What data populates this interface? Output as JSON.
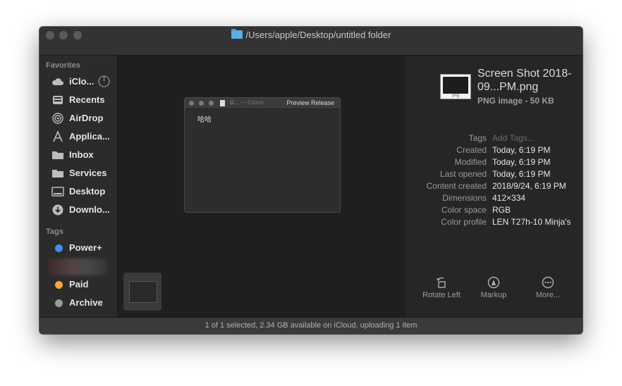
{
  "window": {
    "path": "/Users/apple/Desktop/untitled folder"
  },
  "sidebar": {
    "favorites_title": "Favorites",
    "favorites": [
      {
        "label": "iClo...",
        "icon": "cloud-icon"
      },
      {
        "label": "Recents",
        "icon": "clock-icon"
      },
      {
        "label": "AirDrop",
        "icon": "airdrop-icon"
      },
      {
        "label": "Applica...",
        "icon": "applications-icon"
      },
      {
        "label": "Inbox",
        "icon": "folder-icon"
      },
      {
        "label": "Services",
        "icon": "folder-icon"
      },
      {
        "label": "Desktop",
        "icon": "desktop-icon"
      },
      {
        "label": "Downlo...",
        "icon": "download-icon"
      }
    ],
    "tags_title": "Tags",
    "tags": [
      {
        "label": "Power+",
        "color": "#3b8ff3"
      },
      {
        "label": "Paid",
        "color": "#f6a93a"
      },
      {
        "label": "Archive",
        "color": "#9a9a9a"
      }
    ]
  },
  "preview_window": {
    "title": "U...",
    "edited": "— Edited",
    "app": "Preview Release",
    "content": "哈哈"
  },
  "preview": {
    "file_name": "Screen Shot 2018-09...PM.png",
    "file_type": "PNG image - 50 KB",
    "icon_label": "png",
    "info": [
      {
        "key": "Tags",
        "value": "Add Tags..."
      },
      {
        "key": "Created",
        "value": "Today, 6:19 PM"
      },
      {
        "key": "Modified",
        "value": "Today, 6:19 PM"
      },
      {
        "key": "Last opened",
        "value": "Today, 6:19 PM"
      },
      {
        "key": "Content created",
        "value": "2018/9/24, 6:19 PM"
      },
      {
        "key": "Dimensions",
        "value": "412×334"
      },
      {
        "key": "Color space",
        "value": "RGB"
      },
      {
        "key": "Color profile",
        "value": "LEN T27h-10 Minja's"
      }
    ],
    "actions": [
      {
        "label": "Rotate Left",
        "icon": "rotate-left-icon"
      },
      {
        "label": "Markup",
        "icon": "markup-icon"
      },
      {
        "label": "More...",
        "icon": "more-icon"
      }
    ]
  },
  "status": {
    "text": "1 of 1 selected, 2.34 GB available on iCloud, uploading 1 item"
  }
}
